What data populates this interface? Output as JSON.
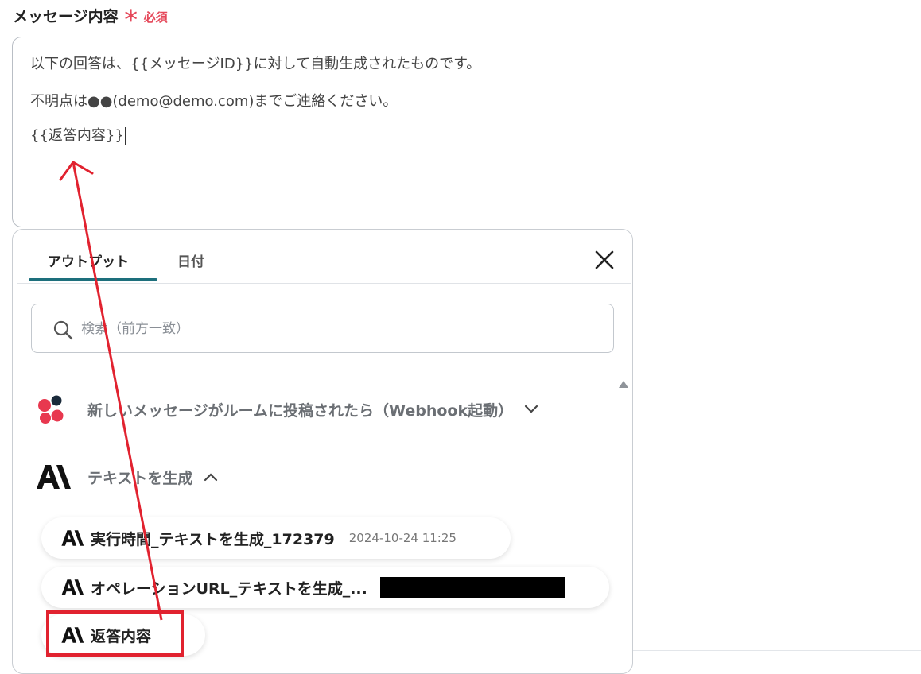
{
  "field": {
    "label": "メッセージ内容",
    "required_mark": "＊",
    "required_text": "必須"
  },
  "message_lines": [
    "以下の回答は、{{メッセージID}}に対して自動生成されたものです。",
    "不明点は●●(demo@demo.com)までご連絡ください。",
    "{{返答内容}}"
  ],
  "panel": {
    "tabs": [
      {
        "label": "アウトプット",
        "active": true
      },
      {
        "label": "日付",
        "active": false
      }
    ],
    "search": {
      "placeholder": "検索（前方一致）",
      "value": ""
    },
    "groups": [
      {
        "label": "新しいメッセージがルームに投稿されたら（Webhook起動）",
        "icon": "app-logo-icon",
        "expanded": false
      },
      {
        "label": "テキストを生成",
        "icon": "ai-logo-icon",
        "expanded": true
      }
    ],
    "items": [
      {
        "label": "実行時間_テキストを生成_172379",
        "value": "2024-10-24 11:25"
      },
      {
        "label": "オペレーションURL_テキストを生成_...",
        "value_redacted": true
      },
      {
        "label": "返答内容"
      }
    ]
  },
  "colors": {
    "accent_tab": "#1d6f7c",
    "required": "#e5485a",
    "annotation_red": "#e1222f"
  }
}
